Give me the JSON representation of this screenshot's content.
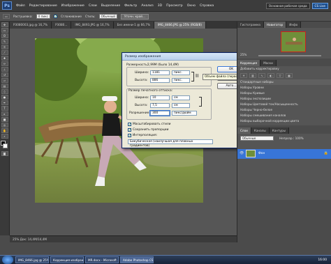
{
  "menubar": {
    "logo": "Ps",
    "items": [
      "Файл",
      "Редактирование",
      "Изображение",
      "Слои",
      "Выделение",
      "Фильтр",
      "Анализ",
      "3D",
      "Просмотр",
      "Окно",
      "Справка"
    ],
    "workspace": "Основная рабочая среда",
    "cslive": "CS Live"
  },
  "options": {
    "feather_label": "Растушевка:",
    "feather_value": "0 пикс",
    "smooth_label": "Сглаживание",
    "style_label": "Стиль:",
    "style_value": "Обычный",
    "refine_button": "Уточн. край..."
  },
  "tabs": [
    "P3080003.jpg @ 16,7%",
    "P3080...",
    "IMG_8493.JPG @ 16,7%",
    "Без имени-1 @ 66,7%",
    "IMG_8466.JPG @ 25% (RGB/8)"
  ],
  "active_tab": 4,
  "status": "25%   Док: 14,4M/14,4M",
  "dialog": {
    "title": "Размер изображения",
    "dimensions_label": "Размерность:",
    "dimensions_value": "2,99M (было 14,4M)",
    "width_label": "Ширина:",
    "width_value": "1181",
    "height_label": "Высота:",
    "height_value": "886",
    "px_unit": "пикс.",
    "print_group": "Размер печатного оттиска:",
    "pwidth_label": "Ширина:",
    "pwidth_value": "10",
    "pheight_label": "Высота:",
    "pheight_value": "7,5",
    "cm_unit": "см",
    "res_label": "Разрешение:",
    "res_value": "300",
    "res_unit": "пикс/дюйм",
    "cb_scale": "Масштабировать стили",
    "cb_constrain": "Сохранить пропорции",
    "cb_resample": "Интерполяция:",
    "resample_value": "Бикубическая (наилучшая для плавных градиентов)",
    "ok": "OK",
    "cancel": "Отмена",
    "auto": "Авто..."
  },
  "tooltip": "Объем файла (первоначальный объем)",
  "rpanel": {
    "top_tabs": [
      "Гистограмма",
      "Навигатор",
      "Инфо"
    ],
    "zoom": "25%",
    "adj_tabs": [
      "Коррекция",
      "Маски"
    ],
    "adj_title": "Добавить корректировку",
    "presets": [
      "Стандартные наборы",
      "Наборы Уровни",
      "Наборы Кривые",
      "Наборы экспозиции",
      "Наборы Цветовой тон/Насыщенность",
      "Наборы Черно-белое",
      "Наборы смешивания каналов",
      "Наборы выборочной коррекции цвета"
    ],
    "layers_tabs": [
      "Слои",
      "Каналы",
      "Контуры"
    ],
    "blend": "Обычные",
    "opacity": "Непрозр.: 100%",
    "layer_name": "Фон"
  },
  "taskbar": {
    "tasks": [
      "IMG_8466.jpg @ 25% (R...",
      "Коррекция изображ...",
      "MR.docx - Microsoft ...",
      "Adobe Photoshop CS5"
    ],
    "active": 3,
    "clock": "16:00"
  },
  "colors": {
    "dialog_bg": "#ece9d8",
    "title_grad": "#b9d1ec",
    "highlight": "#3875d7",
    "accent": "#1c4f8f"
  }
}
